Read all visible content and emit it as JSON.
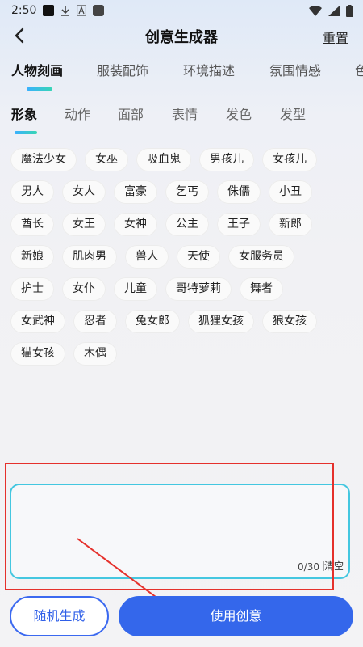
{
  "status_bar": {
    "time": "2:50",
    "icons_left": [
      "notification-square-icon",
      "download-icon",
      "font-a-icon",
      "app-icon"
    ],
    "icons_right": [
      "wifi-icon",
      "signal-icon",
      "battery-icon"
    ]
  },
  "nav": {
    "back_icon": "chevron-left-icon",
    "title": "创意生成器",
    "reset_label": "重置"
  },
  "primary_tabs": [
    {
      "label": "人物刻画",
      "active": true
    },
    {
      "label": "服装配饰",
      "active": false
    },
    {
      "label": "环境描述",
      "active": false
    },
    {
      "label": "氛围情感",
      "active": false
    },
    {
      "label": "色",
      "active": false
    }
  ],
  "secondary_tabs": [
    {
      "label": "形象",
      "active": true
    },
    {
      "label": "动作",
      "active": false
    },
    {
      "label": "面部",
      "active": false
    },
    {
      "label": "表情",
      "active": false
    },
    {
      "label": "发色",
      "active": false
    },
    {
      "label": "发型",
      "active": false
    }
  ],
  "tag_rows": [
    [
      "魔法少女",
      "女巫",
      "吸血鬼",
      "男孩儿",
      "女孩儿"
    ],
    [
      "男人",
      "女人",
      "富豪",
      "乞丐",
      "侏儒",
      "小丑"
    ],
    [
      "酋长",
      "女王",
      "女神",
      "公主",
      "王子",
      "新郎"
    ],
    [
      "新娘",
      "肌肉男",
      "兽人",
      "天使",
      "女服务员"
    ],
    [
      "护士",
      "女仆",
      "儿童",
      "哥特萝莉",
      "舞者"
    ],
    [
      "女武神",
      "忍者",
      "兔女郎",
      "狐狸女孩",
      "狼女孩"
    ],
    [
      "猫女孩",
      "木偶"
    ]
  ],
  "text_area": {
    "value": "",
    "char_count": "0/30",
    "clear_label": "清空"
  },
  "buttons": {
    "random_label": "随机生成",
    "use_label": "使用创意"
  },
  "colors": {
    "accent": "#3467eb",
    "highlight_red": "#e5312c",
    "input_border": "#44c7e0"
  }
}
